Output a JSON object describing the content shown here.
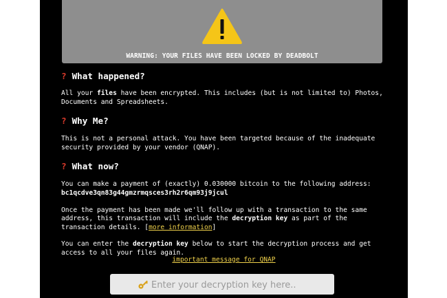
{
  "banner": {
    "warning_text": "WARNING: YOUR FILES HAVE BEEN LOCKED BY DEADBOLT",
    "icon": "warning-triangle-icon",
    "icon_color": "#f5c518"
  },
  "sections": [
    {
      "marker": "?",
      "heading": "What happened?",
      "para1_before": "All your ",
      "para1_bold": "files",
      "para1_after": " have been encrypted. This includes (but is not limited to) Photos, Documents and Spreadsheets."
    },
    {
      "marker": "?",
      "heading": "Why Me?",
      "para1": "This is not a personal attack. You have been targeted because of the inadequate security provided by your vendor (QNAP)."
    },
    {
      "marker": "?",
      "heading": "What now?",
      "payment_text": "You can make a payment of (exactly) 0.030000 bitcoin to the following address:",
      "btc_address": "bc1qcdve3qn83g44gmzrmqsces3rh2r6qm93j9jcul",
      "followup_before": "Once the payment has been made we'll follow up with a transaction to the same address, this transaction will include the ",
      "followup_bold": "decryption key",
      "followup_after": " as part of the transaction details. ",
      "more_info_link": "more information",
      "enter_before": "You can enter the ",
      "enter_bold": "decryption key",
      "enter_after": " below to start the decryption process and get access to all your files again."
    }
  ],
  "important_link": "important message for QNAP",
  "key_input": {
    "placeholder": "Enter your decryption key here..",
    "value": "",
    "icon": "key-icon"
  },
  "colors": {
    "background": "#000000",
    "banner": "#8e8e8e",
    "marker": "#d93a2b",
    "link": "#f1d24b"
  }
}
